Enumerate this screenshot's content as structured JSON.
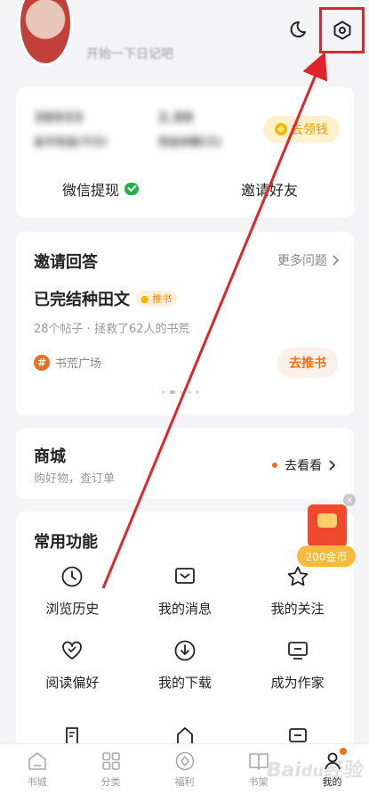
{
  "header": {
    "profile_sub": "开始一下日记吧",
    "icons": [
      "moon-icon",
      "settings-hexagon-icon"
    ]
  },
  "wallet": {
    "stat1_value": "38933",
    "stat1_label": "金币收益(今日)",
    "stat2_value": "2.88",
    "stat2_label": "现金余额(元)",
    "coin_button": "去领钱",
    "wechat_withdraw": "微信提现",
    "invite_friends": "邀请好友"
  },
  "invite_answer": {
    "title": "邀请回答",
    "more": "更多问题",
    "question": "已完结种田文",
    "tag": "推书",
    "meta": "28个帖子 · 拯救了62人的书荒",
    "topic": "书荒广场",
    "action": "去推书"
  },
  "mall": {
    "title": "商城",
    "subtitle": "购好物，查订单",
    "action": "去看看"
  },
  "functions": {
    "title": "常用功能",
    "items": [
      {
        "label": "浏览历史",
        "icon": "clock-icon"
      },
      {
        "label": "我的消息",
        "icon": "message-icon"
      },
      {
        "label": "我的关注",
        "icon": "star-icon"
      },
      {
        "label": "阅读偏好",
        "icon": "heart-icon"
      },
      {
        "label": "我的下载",
        "icon": "download-icon"
      },
      {
        "label": "成为作家",
        "icon": "monitor-icon"
      }
    ]
  },
  "floating": {
    "gold_coins": "200金币"
  },
  "bottom_nav": [
    {
      "label": "书城",
      "icon": "home-icon"
    },
    {
      "label": "分类",
      "icon": "grid-icon"
    },
    {
      "label": "福利",
      "icon": "gift-icon"
    },
    {
      "label": "书架",
      "icon": "bookshelf-icon"
    },
    {
      "label": "我的",
      "icon": "user-icon"
    }
  ],
  "watermark": "Baidu经验",
  "colors": {
    "accent": "#f06f1e",
    "annotation_red": "#e0242b",
    "wechat_green": "#19b34a",
    "gold": "#f9b93e"
  }
}
